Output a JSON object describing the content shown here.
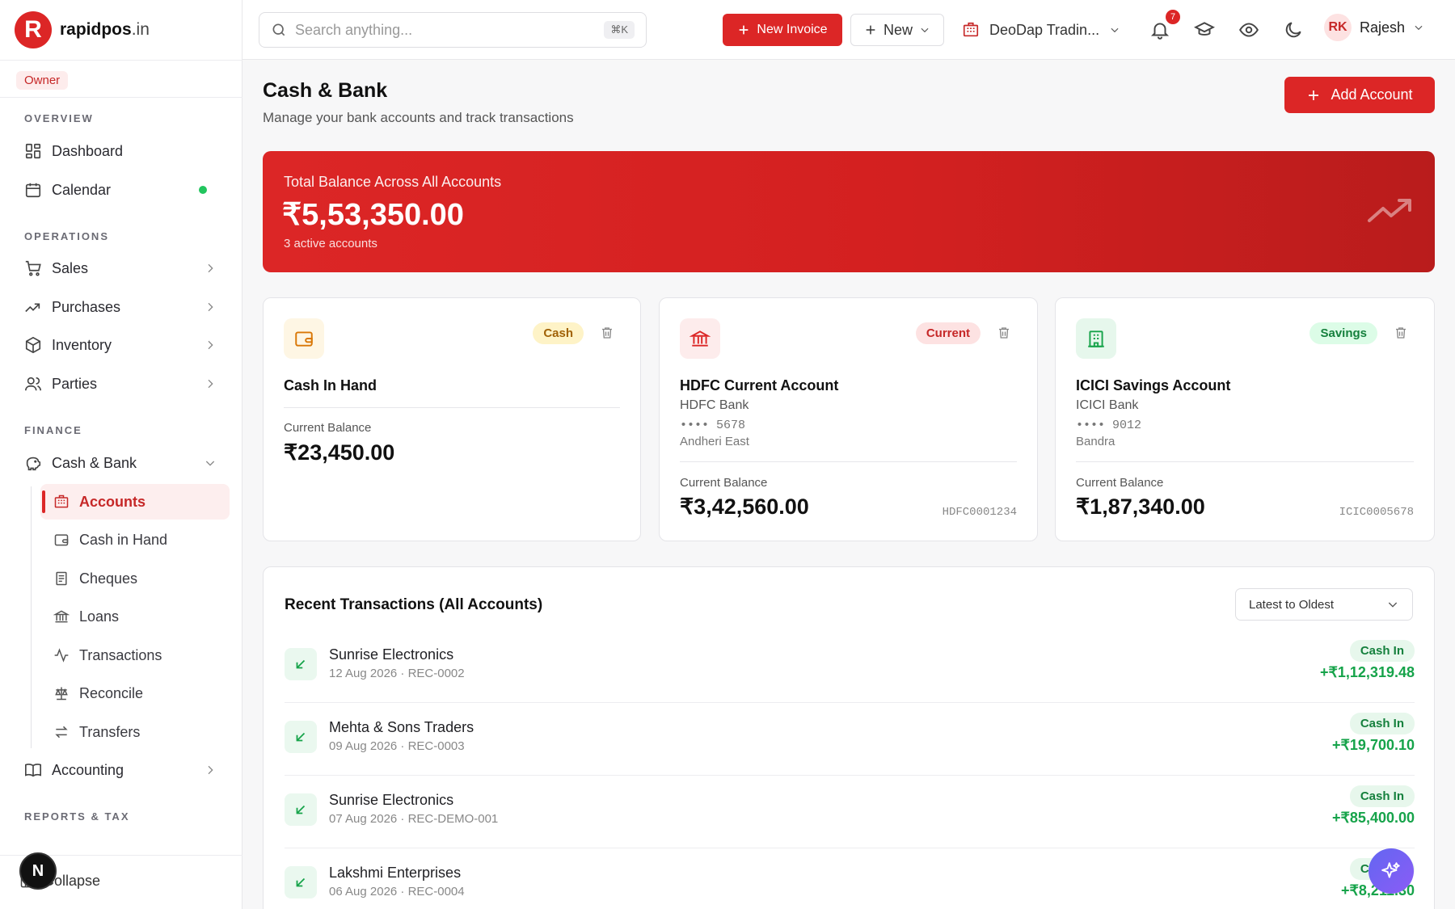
{
  "app": {
    "logo_text": "rapidpos",
    "logo_tld": ".in",
    "logo_letter": "R"
  },
  "sidebar": {
    "role": "Owner",
    "sections": {
      "overview": "OVERVIEW",
      "operations": "OPERATIONS",
      "finance": "FINANCE",
      "reports": "REPORTS & TAX"
    },
    "items": {
      "dashboard": "Dashboard",
      "calendar": "Calendar",
      "sales": "Sales",
      "purchases": "Purchases",
      "inventory": "Inventory",
      "parties": "Parties",
      "cash_bank": "Cash & Bank",
      "accounting": "Accounting"
    },
    "sub_items": {
      "accounts": "Accounts",
      "cash_in_hand": "Cash in Hand",
      "cheques": "Cheques",
      "loans": "Loans",
      "transactions": "Transactions",
      "reconcile": "Reconcile",
      "transfers": "Transfers"
    },
    "collapse": "Collapse",
    "avatar_letter": "N",
    "calendar_dot_color": "#22c55e"
  },
  "topbar": {
    "search_placeholder": "Search anything...",
    "search_shortcut": "⌘K",
    "new_invoice": "New Invoice",
    "new": "New",
    "company": "DeoDap Tradin...",
    "notifications": "7",
    "user_initials": "RK",
    "user_name": "Rajesh"
  },
  "page": {
    "title": "Cash & Bank",
    "subtitle": "Manage your bank accounts and track transactions",
    "add_account": "Add Account"
  },
  "balance": {
    "label": "Total Balance Across All Accounts",
    "amount": "₹5,53,350.00",
    "count": "3 active accounts"
  },
  "accounts": [
    {
      "name": "Cash In Hand",
      "type": "Cash",
      "balance_label": "Current Balance",
      "balance": "₹23,450.00"
    },
    {
      "name": "HDFC Current Account",
      "type": "Current",
      "bank": "HDFC Bank",
      "masked": "•••• 5678",
      "branch": "Andheri East",
      "balance_label": "Current Balance",
      "balance": "₹3,42,560.00",
      "ifsc": "HDFC0001234"
    },
    {
      "name": "ICICI Savings Account",
      "type": "Savings",
      "bank": "ICICI Bank",
      "masked": "•••• 9012",
      "branch": "Bandra",
      "balance_label": "Current Balance",
      "balance": "₹1,87,340.00",
      "ifsc": "ICIC0005678"
    }
  ],
  "transactions": {
    "title": "Recent Transactions (All Accounts)",
    "sort": "Latest to Oldest",
    "rows": [
      {
        "party": "Sunrise Electronics",
        "meta": "12 Aug 2026 · REC-0002",
        "type": "Cash In",
        "amount": "+₹1,12,319.48"
      },
      {
        "party": "Mehta & Sons Traders",
        "meta": "09 Aug 2026 · REC-0003",
        "type": "Cash In",
        "amount": "+₹19,700.10"
      },
      {
        "party": "Sunrise Electronics",
        "meta": "07 Aug 2026 · REC-DEMO-001",
        "type": "Cash In",
        "amount": "+₹85,400.00"
      },
      {
        "party": "Lakshmi Enterprises",
        "meta": "06 Aug 2026 · REC-0004",
        "type": "Cash In",
        "amount": "+₹8,211.30"
      }
    ]
  },
  "colors": {
    "brand": "#dc2626",
    "success": "#16a34a",
    "cash_pill": "#fef3c7",
    "current_pill": "#fde2e2",
    "savings_pill": "#dcfce7"
  }
}
